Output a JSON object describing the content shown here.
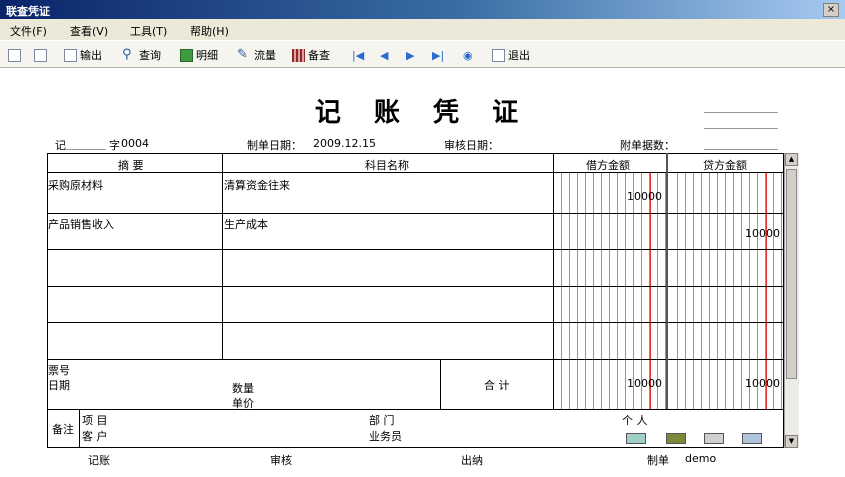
{
  "window": {
    "title": "联查凭证",
    "close_glyph": "×"
  },
  "menu": [
    "文件(F)",
    "查看(V)",
    "工具(T)",
    "帮助(H)"
  ],
  "toolbar": {
    "output": "输出",
    "query": "查询",
    "detail": "明细",
    "flow": "流量",
    "note": "备查",
    "exit": "退出"
  },
  "voucher": {
    "title": "记 账 凭 证",
    "type": "记",
    "number_label": "字",
    "number": "0004",
    "date_label": "制单日期：",
    "date": "2009.12.15",
    "audit_date_label": "审核日期：",
    "attach_label": "附单据数："
  },
  "table": {
    "headers": [
      "摘 要",
      "科目名称",
      "借方金额",
      "贷方金额"
    ],
    "rows": [
      {
        "summary": "采购原材料",
        "account": "清算资金往来",
        "debit": "10000",
        "credit": ""
      },
      {
        "summary": "产品销售收入",
        "account": "生产成本",
        "debit": "",
        "credit": "10000"
      }
    ],
    "footer": {
      "ticket_label": "票号",
      "date_label": "日期",
      "qty_label": "数量",
      "price_label": "单价",
      "total_label": "合 计",
      "total_debit": "10000",
      "total_credit": "10000"
    },
    "remarks": {
      "label": "备注",
      "project_label": "项  目",
      "customer_label": "客  户",
      "dept_label": "部  门",
      "staff_label": "业务员",
      "person_label": "个  人"
    }
  },
  "signatures": {
    "bookkeep": "记账",
    "audit": "审核",
    "cashier": "出纳",
    "maker_label": "制单",
    "maker": "demo"
  }
}
